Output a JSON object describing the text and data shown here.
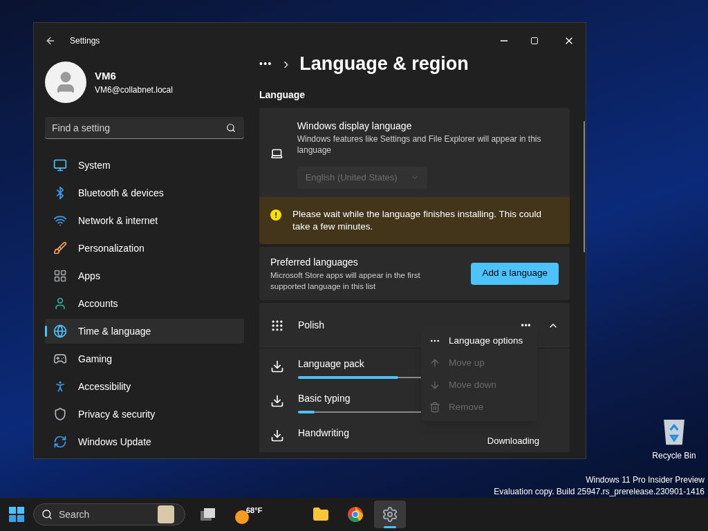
{
  "window": {
    "title": "Settings"
  },
  "account": {
    "name": "VM6",
    "email": "VM6@collabnet.local"
  },
  "search": {
    "placeholder": "Find a setting"
  },
  "sidebar": {
    "items": [
      {
        "label": "System",
        "selected": false
      },
      {
        "label": "Bluetooth & devices",
        "selected": false
      },
      {
        "label": "Network & internet",
        "selected": false
      },
      {
        "label": "Personalization",
        "selected": false
      },
      {
        "label": "Apps",
        "selected": false
      },
      {
        "label": "Accounts",
        "selected": false
      },
      {
        "label": "Time & language",
        "selected": true
      },
      {
        "label": "Gaming",
        "selected": false
      },
      {
        "label": "Accessibility",
        "selected": false
      },
      {
        "label": "Privacy & security",
        "selected": false
      },
      {
        "label": "Windows Update",
        "selected": false
      }
    ]
  },
  "breadcrumb": {
    "overflow": "•••",
    "separator": "›",
    "title": "Language & region"
  },
  "section_title": "Language",
  "display_language": {
    "title": "Windows display language",
    "description": "Windows features like Settings and File Explorer will appear in this language",
    "value": "English (United States)",
    "disabled": true
  },
  "warning": {
    "icon": "!",
    "text": "Please wait while the language finishes installing. This could take a few minutes."
  },
  "preferred": {
    "title": "Preferred languages",
    "description": "Microsoft Store apps will appear in the first supported language in this list",
    "button": "Add a language"
  },
  "language": {
    "name": "Polish",
    "more": "•••",
    "expanded": true,
    "features": [
      {
        "label": "Language pack",
        "kind": "progress",
        "level": 0.42
      },
      {
        "label": "Basic typing",
        "kind": "progress",
        "level": 0.07
      },
      {
        "label": "Handwriting",
        "kind": "status",
        "status": "Downloading"
      }
    ]
  },
  "context_menu": {
    "items": [
      {
        "label": "Language options",
        "disabled": false
      },
      {
        "label": "Move up",
        "disabled": true
      },
      {
        "label": "Move down",
        "disabled": true
      },
      {
        "label": "Remove",
        "disabled": true
      }
    ]
  },
  "desktop": {
    "icons": [
      {
        "label": "Recycle Bin"
      }
    ],
    "watermark": [
      "Windows 11 Pro Insider Preview",
      "Evaluation copy. Build 25947.rs_prerelease.230901-1416"
    ]
  },
  "taskbar": {
    "search_placeholder": "Search",
    "weather": "68°F",
    "apps": [
      {
        "selected": false
      },
      {
        "selected": false
      },
      {
        "selected": true
      }
    ]
  }
}
